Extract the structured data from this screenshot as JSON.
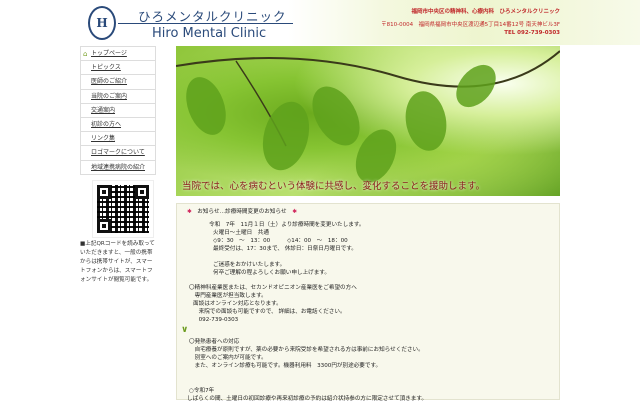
{
  "header": {
    "logo_text": "HMC",
    "title_jp": "ひろメンタルクリニック",
    "title_en": "Hiro Mental Clinic",
    "tagline": "福岡市中央区の精神科、心療内科　ひろメンタルクリニック",
    "address": "〒810-0004　福岡県福岡市中央区渡辺通5丁目14番12号 南天神ビル3F",
    "tel": "TEL 092-739-0303"
  },
  "nav": {
    "items": [
      "トップページ",
      "トピックス",
      "医師のご紹介",
      "当院のご案内",
      "交通案内",
      "初診の方へ",
      "リンク集",
      "ロゴマークについて",
      "地域連携病院の紹介"
    ]
  },
  "sidebar": {
    "qr_note": "■上記QRコードを読み取っていただきますと、一般の携帯からは携帯サイトが、スマートフォンからは、スマートフォンサイトが閲覧可能です。"
  },
  "hero": {
    "caption": "当院では、心を病むという体験に共感し、変化することを援助します。"
  },
  "notice": {
    "title": "お知らせ…診療時間変更のお知らせ",
    "lines1": [
      "令和　7年　11月１日（土）より診療時間を変更いたします。",
      "火曜日〜土曜日　共通",
      "◇9：30　〜　13：00　　　◇14：00　〜　18：00",
      "最終受付は、17：30まで、 休診日：日祭日月曜日です。",
      "",
      "ご迷惑をおかけいたします。",
      "何卒ご理解の程よろしくお願い申し上げます。"
    ],
    "lines2": [
      "〇精神科産業医または、セカンドオピニオン産業医をご希望の方へ",
      "　専門産業医が担当致します。",
      "面談はオンライン対応となります。",
      "　来院での面談も可能ですので、 詳細は、お電話ください。",
      "　092-739-0303"
    ],
    "lines3": [
      "〇発熱患者への対応",
      "　自宅療養が原則ですが、薬の必要から来院受診を希望される方は事前にお知らせください。",
      "　別室へのご案内が可能です。",
      "　また、オンライン診療も可能です。機器利用料　3300円が別途必要です。"
    ],
    "lines4": [
      "○令和7年",
      "しばらくの間、土曜日の初回診療や再来初診療の予約は紹介状持参の方に限定させて頂きます。"
    ]
  }
}
